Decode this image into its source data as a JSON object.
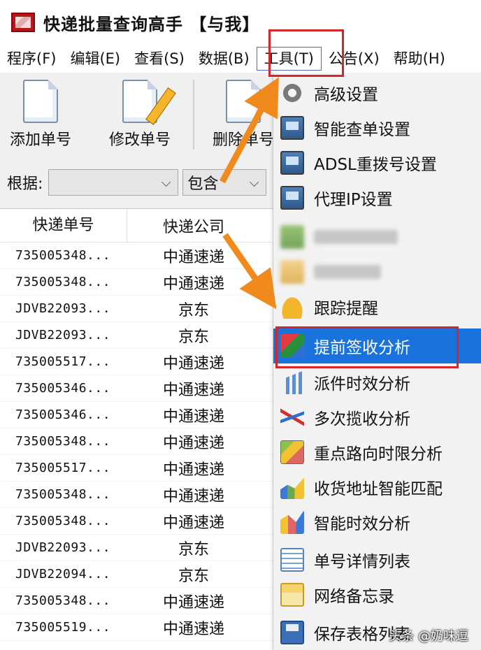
{
  "window": {
    "title": "快递批量查询高手 【与我】"
  },
  "menubar": [
    {
      "label": "程序(F)"
    },
    {
      "label": "编辑(E)"
    },
    {
      "label": "查看(S)"
    },
    {
      "label": "数据(B)"
    },
    {
      "label": "工具(T)",
      "active": true
    },
    {
      "label": "公告(X)"
    },
    {
      "label": "帮助(H)"
    }
  ],
  "toolbar": {
    "add": "添加单号",
    "edit": "修改单号",
    "delete": "删除单号"
  },
  "filter": {
    "label": "根据:",
    "field_value": "",
    "condition_value": "包含"
  },
  "table": {
    "columns": [
      "快递单号",
      "快递公司"
    ],
    "rows": [
      [
        "735005348...",
        "中通速递"
      ],
      [
        "735005348...",
        "中通速递"
      ],
      [
        "JDVB22093...",
        "京东"
      ],
      [
        "JDVB22093...",
        "京东"
      ],
      [
        "735005517...",
        "中通速递"
      ],
      [
        "735005346...",
        "中通速递"
      ],
      [
        "735005346...",
        "中通速递"
      ],
      [
        "735005348...",
        "中通速递"
      ],
      [
        "735005517...",
        "中通速递"
      ],
      [
        "735005348...",
        "中通速递"
      ],
      [
        "735005348...",
        "中通速递"
      ],
      [
        "JDVB22093...",
        "京东"
      ],
      [
        "JDVB22094...",
        "京东"
      ],
      [
        "735005348...",
        "中通速递"
      ],
      [
        "735005519...",
        "中通速递"
      ]
    ]
  },
  "tools_menu": [
    {
      "label": "高级设置",
      "icon": "gear-icon"
    },
    {
      "label": "智能查单设置",
      "icon": "monitor-icon"
    },
    {
      "label": "ADSL重拨号设置",
      "icon": "monitor-icon"
    },
    {
      "label": "代理IP设置",
      "icon": "monitor-icon"
    },
    {
      "label": "",
      "icon": "blurred-icon",
      "blurred": true
    },
    {
      "label": "",
      "icon": "blurred-icon",
      "blurred": true
    },
    {
      "label": "跟踪提醒",
      "icon": "bell-icon"
    },
    {
      "label": "提前签收分析",
      "icon": "cube-icon",
      "highlighted": true
    },
    {
      "label": "派件时效分析",
      "icon": "bar-chart-icon"
    },
    {
      "label": "多次揽收分析",
      "icon": "line-chart-icon"
    },
    {
      "label": "重点路向时限分析",
      "icon": "map-icon"
    },
    {
      "label": "收货地址智能匹配",
      "icon": "chart-icon"
    },
    {
      "label": "智能时效分析",
      "icon": "multi-chart-icon"
    },
    {
      "label": "单号详情列表",
      "icon": "list-icon"
    },
    {
      "label": "网络备忘录",
      "icon": "note-icon"
    },
    {
      "label": "保存表格列表",
      "icon": "save-icon"
    }
  ],
  "watermark": "头条 @奶味逗",
  "colors": {
    "highlight": "#1a73dd",
    "annotation_red": "#d3262a",
    "annotation_arrow": "#f08a1c"
  }
}
